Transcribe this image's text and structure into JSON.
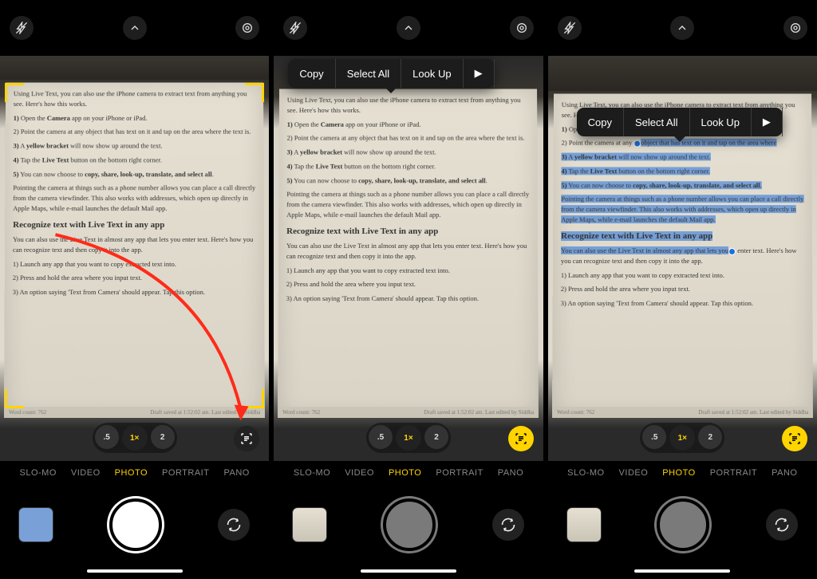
{
  "top_bar": {
    "flash_label": "flash-off",
    "chevron_label": "expand-controls",
    "burst_label": "live-photo"
  },
  "zoom": {
    "half": ".5",
    "one": "1×",
    "two": "2"
  },
  "modes": {
    "slomo": "SLO-MO",
    "video": "VIDEO",
    "photo": "PHOTO",
    "portrait": "PORTRAIT",
    "pano": "PANO"
  },
  "ctx": {
    "copy": "Copy",
    "select_all": "Select All",
    "lookup": "Look Up",
    "more": "▶"
  },
  "doc": {
    "intro": "Using Live Text, you can also use the iPhone camera to extract text from anything you see. Here's how this works.",
    "s1": "1) Open the Camera app on your iPhone or iPad.",
    "s2": "2) Point the camera at any object that has text on it and tap on the area where the text is.",
    "s2a": "2) Point the camera at any ",
    "s2b": "object that has text on it and tap on the area where",
    "s3": "3) A yellow bracket will now show up around the text.",
    "s4": "4) Tap the Live Text button on the bottom right corner.",
    "s5": "5) You can now choose to copy, share, look-up, translate, and select all.",
    "para": "Pointing the camera at things such as a phone number allows you can place a call directly from the camera viewfinder. This also works with addresses, which open up directly in Apple Maps, while e-mail launches the default Mail app.",
    "h3": "Recognize text with Live Text in any app",
    "p2": "You can also use the Live Text in almost any app that lets you enter text. Here's how you can recognize text and then copy it into the app.",
    "s6": "1) Launch any app that you want to copy extracted text into.",
    "s7": "2) Press and hold the area where you input text.",
    "s8": "3) An option saying 'Text from Camera' should appear. Tap this option.",
    "footer": "Draft saved at 1:52:02 am. Last edited by Siddha",
    "wordcount": "Word count: 762"
  }
}
